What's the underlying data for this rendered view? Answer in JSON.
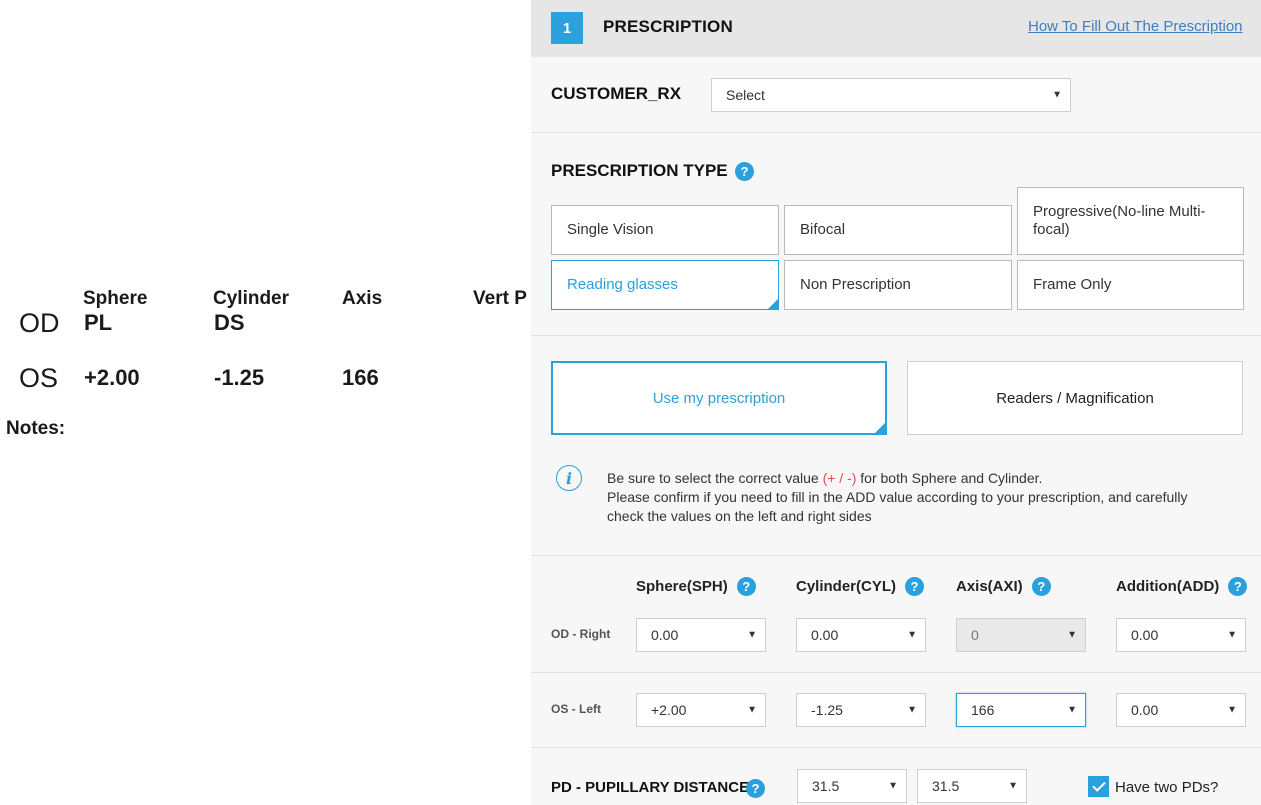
{
  "rx_image": {
    "headers": [
      "Sphere",
      "Cylinder",
      "Axis",
      "Vert P"
    ],
    "od": {
      "eye": "OD",
      "sphere": "PL",
      "cylinder": "DS"
    },
    "os": {
      "eye": "OS",
      "sphere": "+2.00",
      "cylinder": "-1.25",
      "axis": "166"
    },
    "notes": "Notes:"
  },
  "step": {
    "number": "1",
    "title": "PRESCRIPTION",
    "help_link": "How To Fill Out The Prescription"
  },
  "customer_rx": {
    "label": "CUSTOMER_RX",
    "value": "Select"
  },
  "prescription_type": {
    "label": "PRESCRIPTION TYPE",
    "help": "?",
    "options": [
      {
        "label": "Single Vision"
      },
      {
        "label": "Bifocal"
      },
      {
        "label": "Progressive(No-line Multi-focal)"
      },
      {
        "label": "Reading glasses"
      },
      {
        "label": "Non Prescription"
      },
      {
        "label": "Frame Only"
      }
    ],
    "selected": "Reading glasses"
  },
  "reading_mode": {
    "options": [
      {
        "label": "Use my prescription"
      },
      {
        "label": "Readers / Magnification"
      }
    ],
    "selected": "Use my prescription"
  },
  "info": {
    "icon": "i",
    "line1_pre": "Be sure to select the correct value ",
    "line1_warn": "(+ / -)",
    "line1_post": " for both Sphere and Cylinder.",
    "line2": "Please confirm if you need to fill in the ADD value according to your prescription, and carefully check the values on the left and right sides"
  },
  "table": {
    "columns": [
      {
        "label": "Sphere(SPH)",
        "help": "?"
      },
      {
        "label": "Cylinder(CYL)",
        "help": "?"
      },
      {
        "label": "Axis(AXI)",
        "help": "?"
      },
      {
        "label": "Addition(ADD)",
        "help": "?"
      }
    ],
    "rows": [
      {
        "label": "OD - Right",
        "values": [
          "0.00",
          "0.00",
          "0",
          "0.00"
        ]
      },
      {
        "label": "OS - Left",
        "values": [
          "+2.00",
          "-1.25",
          "166",
          "0.00"
        ]
      }
    ]
  },
  "pd": {
    "label": "PD - PUPILLARY DISTANCE",
    "help": "?",
    "right": "31.5",
    "left": "31.5",
    "two_pds_label": "Have two PDs?",
    "two_pds_checked": true
  },
  "icons": {
    "dropdown": "chevron-down-icon",
    "help": "question-icon",
    "info": "info-icon",
    "check": "check-icon"
  },
  "colors": {
    "accent": "#2aa0dc",
    "link": "#3d7fbf",
    "warning": "#e24a4a",
    "header_bg": "#e6e6e6",
    "panel_bg": "#f7f7f7"
  }
}
